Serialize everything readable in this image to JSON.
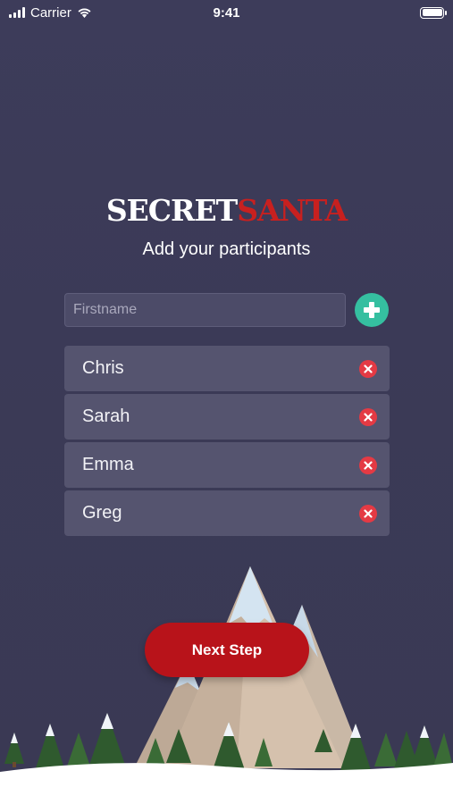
{
  "status_bar": {
    "carrier": "Carrier",
    "time": "9:41"
  },
  "logo": {
    "part1": "SECRET",
    "part2": "SANTA"
  },
  "subtitle": "Add your participants",
  "input": {
    "placeholder": "Firstname",
    "value": ""
  },
  "participants": [
    {
      "name": "Chris"
    },
    {
      "name": "Sarah"
    },
    {
      "name": "Emma"
    },
    {
      "name": "Greg"
    }
  ],
  "next_button": {
    "label": "Next Step"
  },
  "colors": {
    "background": "#3b3a57",
    "accent_green": "#35bfa0",
    "remove_red": "#e43a44",
    "button_red": "#b8131a",
    "logo_red": "#c8201f"
  },
  "icons": {
    "add": "plus-circle-icon",
    "remove": "x-circle-icon",
    "wifi": "wifi-icon",
    "battery": "battery-icon",
    "signal": "signal-icon"
  }
}
